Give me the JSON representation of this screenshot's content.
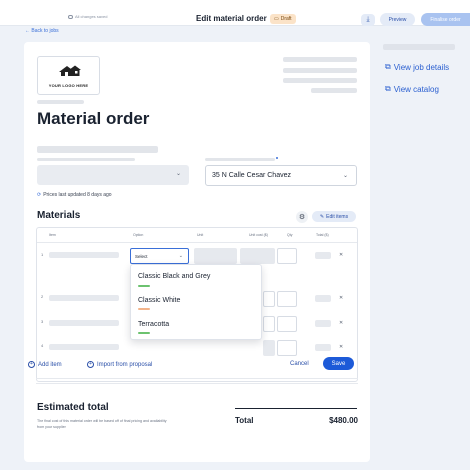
{
  "topbar": {
    "saved_status": "All changes saved",
    "title": "Edit material order",
    "draft_badge": "Draft",
    "preview_label": "Preview",
    "finalise_label": "Finalise order"
  },
  "back_link": "← Back to jobs",
  "logo_text": "YOUR LOGO HERE",
  "heading": "Material order",
  "address_value": "35 N Calle Cesar Chavez",
  "prices_updated": "Prices last updated 8 days ago",
  "materials": {
    "heading": "Materials",
    "edit_items_label": "Edit items",
    "columns": [
      "Item",
      "Option",
      "Unit",
      "Unit cost ($)",
      "Qty",
      "Total ($)"
    ],
    "row_numbers": [
      "1",
      "2",
      "3",
      "4"
    ],
    "select_value": "Select",
    "options": [
      {
        "label": "Classic Black and Grey",
        "color": "#6cc26f"
      },
      {
        "label": "Classic White",
        "color": "#f3b48a"
      },
      {
        "label": "Terracotta",
        "color": "#6cc26f"
      }
    ],
    "add_item_label": "Add item",
    "import_label": "Import from proposal",
    "cancel_label": "Cancel",
    "save_label": "Save"
  },
  "estimate": {
    "heading": "Estimated total",
    "note": "The final cost of this material order will be based off of final pricing and availability from your supplier",
    "total_label": "Total",
    "total_value": "$480.00"
  },
  "side_links": {
    "view_job": "View job details",
    "view_catalog": "View catalog"
  }
}
